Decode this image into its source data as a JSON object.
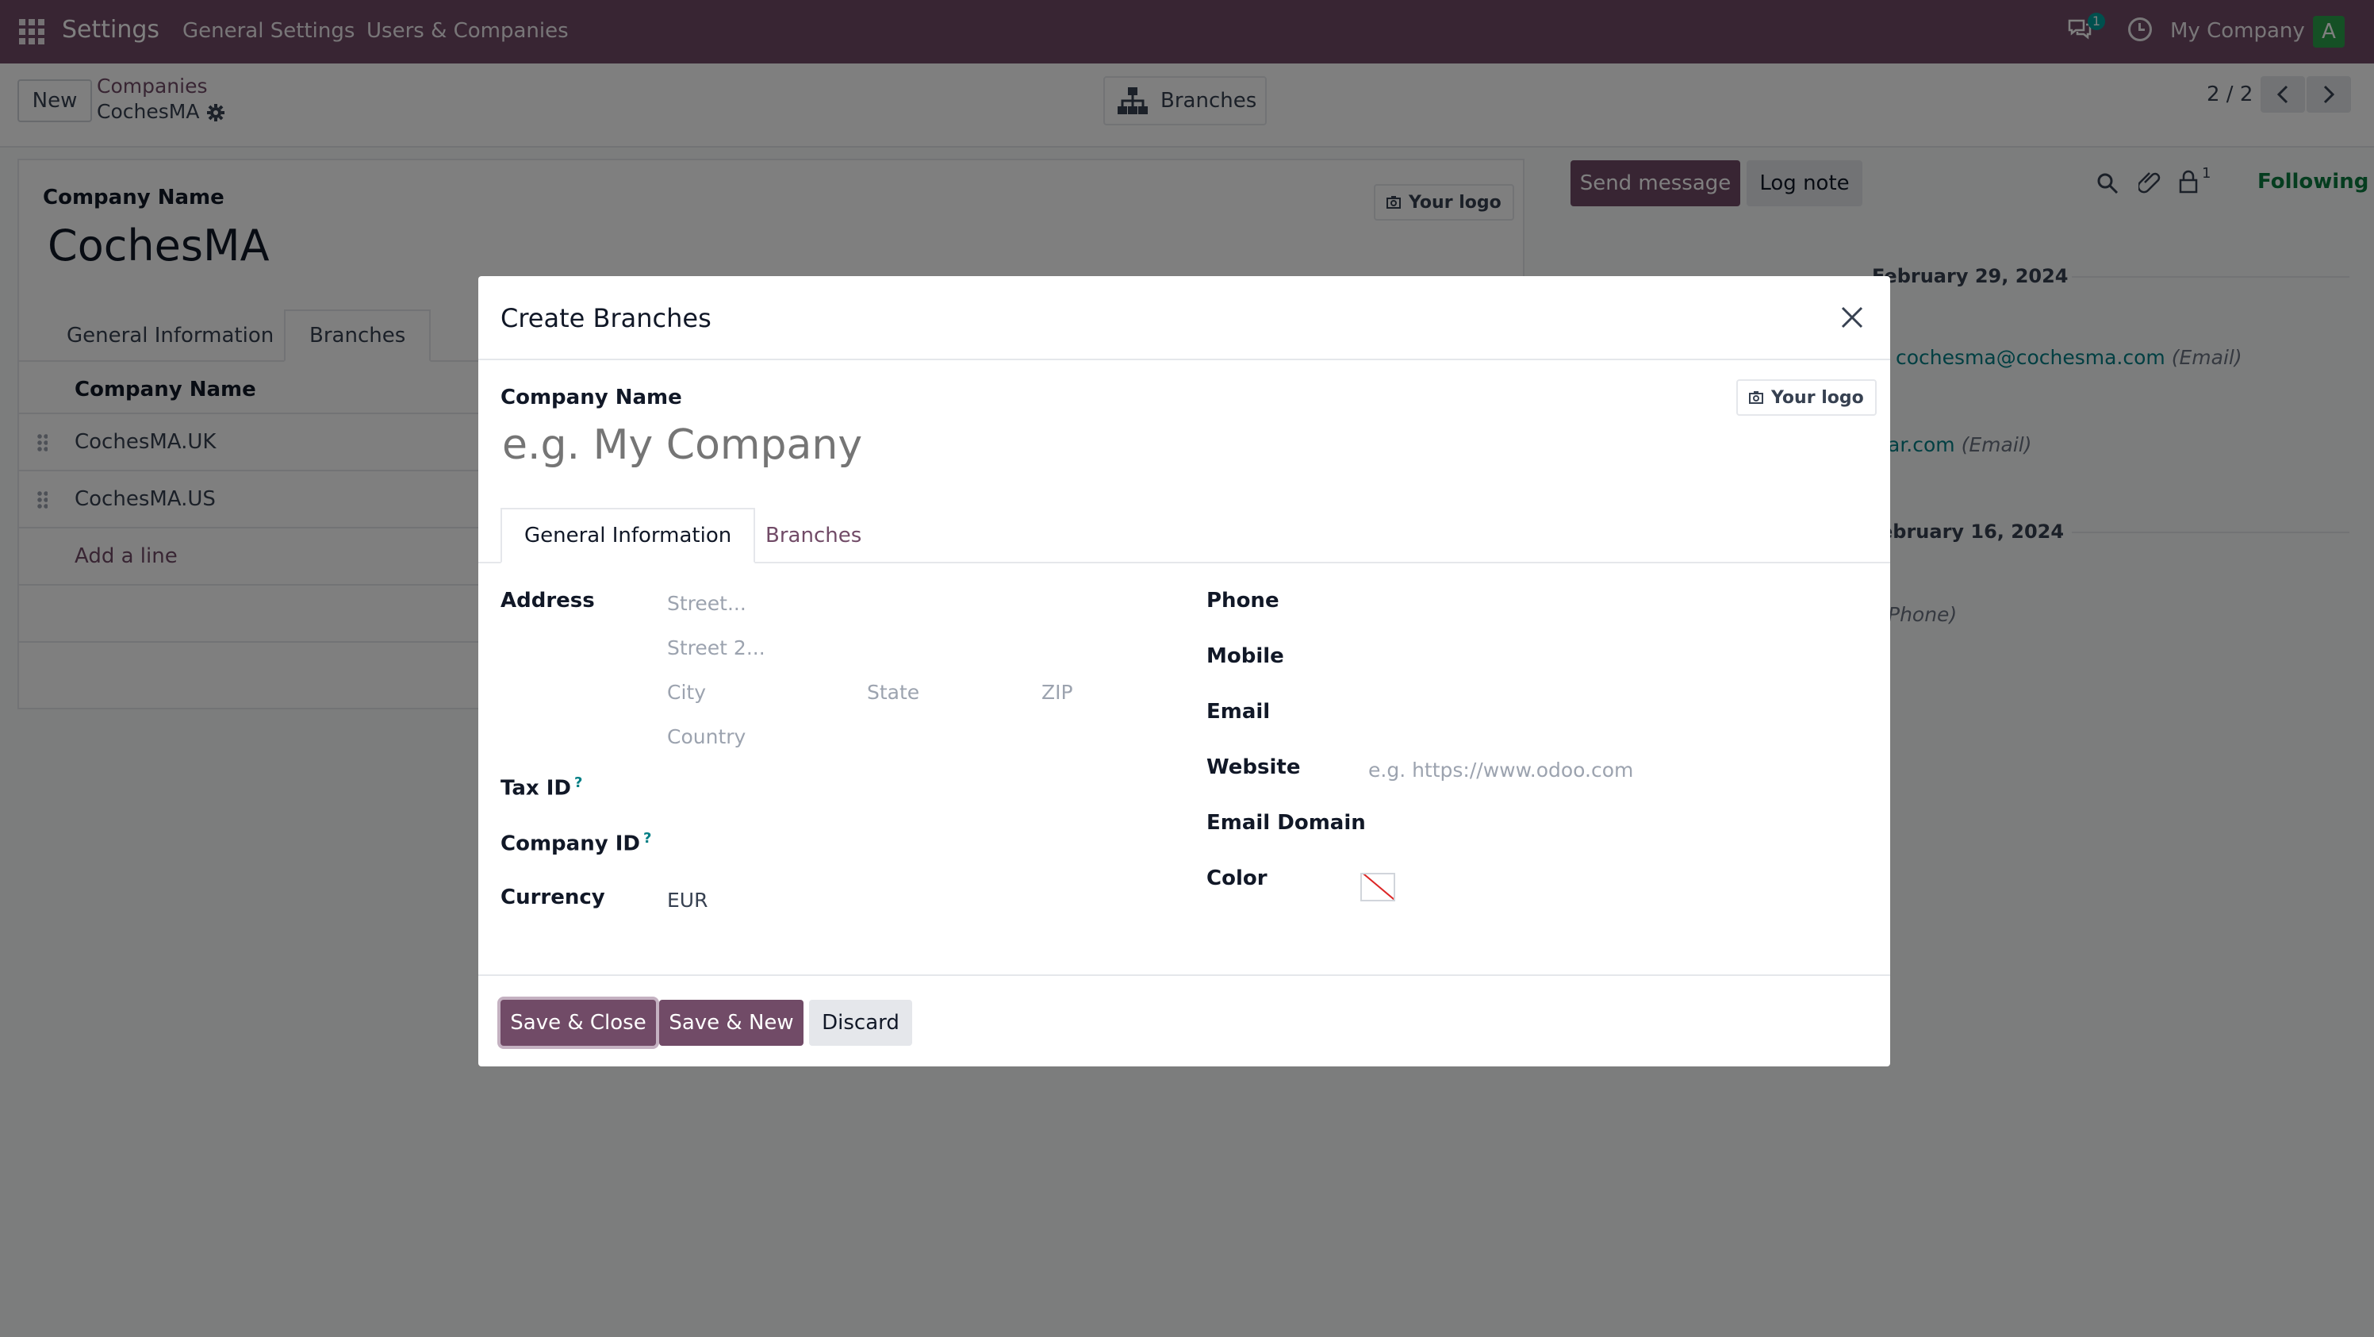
{
  "navbar": {
    "app_name": "Settings",
    "menu": [
      "General Settings",
      "Users & Companies"
    ],
    "chat_badge": "1",
    "company": "My Company",
    "avatar_letter": "A"
  },
  "control": {
    "new_label": "New",
    "breadcrumb_parent": "Companies",
    "breadcrumb_current": "CochesMA",
    "branches_button": "Branches",
    "pager": "2 / 2"
  },
  "sheet": {
    "company_name_label": "Company Name",
    "company_name": "CochesMA",
    "logo_label": "Your logo",
    "tabs": [
      "General Information",
      "Branches"
    ],
    "list_header": "Company Name",
    "rows": [
      "CochesMA.UK",
      "CochesMA.US"
    ],
    "add_line": "Add a line"
  },
  "chatter": {
    "send_message": "Send message",
    "log_note": "Log note",
    "followers_count": "1",
    "following": "Following",
    "date1": "February 29, 2024",
    "msg1_link": "cochesma@cochesma.com",
    "msg1_sub": "(Email)",
    "msg2_link": "ar.com",
    "msg2_sub": "(Email)",
    "date2": "ebruary 16, 2024",
    "msg3_sub": "Phone)"
  },
  "modal": {
    "title": "Create Branches",
    "company_name_label": "Company Name",
    "company_name_placeholder": "e.g. My Company",
    "logo_label": "Your logo",
    "tabs": [
      "General Information",
      "Branches"
    ],
    "address_label": "Address",
    "street_placeholder": "Street...",
    "street2_placeholder": "Street 2...",
    "city_placeholder": "City",
    "state_placeholder": "State",
    "zip_placeholder": "ZIP",
    "country_placeholder": "Country",
    "tax_id_label": "Tax ID",
    "company_id_label": "Company ID",
    "help_mark": "?",
    "currency_label": "Currency",
    "currency_value": "EUR",
    "phone_label": "Phone",
    "mobile_label": "Mobile",
    "email_label": "Email",
    "website_label": "Website",
    "website_placeholder": "e.g. https://www.odoo.com",
    "email_domain_label": "Email Domain",
    "color_label": "Color",
    "save_close": "Save & Close",
    "save_new": "Save & New",
    "discard": "Discard"
  }
}
